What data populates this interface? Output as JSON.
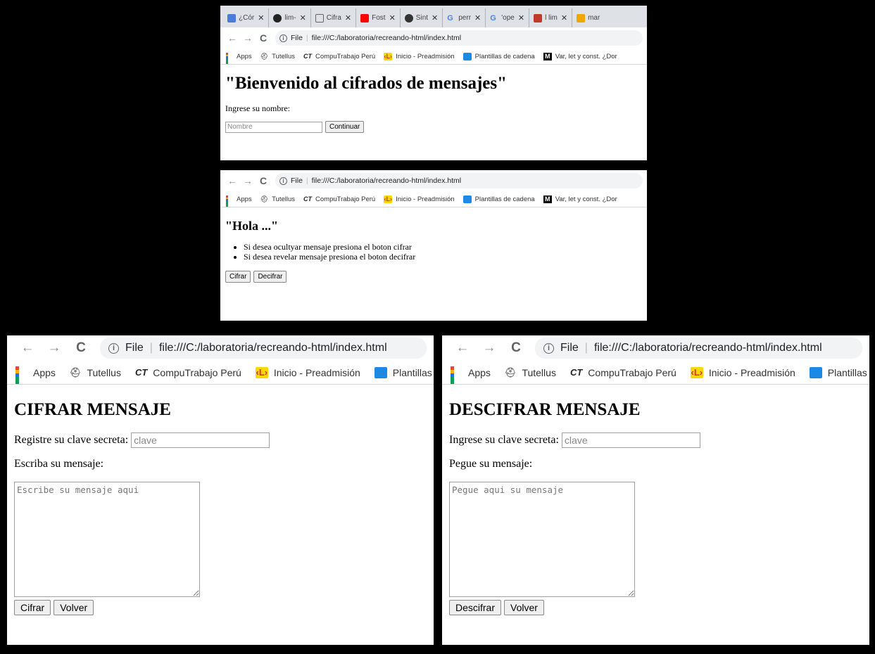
{
  "browser": {
    "tabs": [
      {
        "label": "¿Cór",
        "icon": "translate-icon",
        "color": "#4a7ddb"
      },
      {
        "label": "lim-",
        "icon": "github-icon",
        "color": "#222222"
      },
      {
        "label": "Cifra",
        "icon": "file-icon",
        "color": "#ffffff"
      },
      {
        "label": "Fost",
        "icon": "youtube-icon",
        "color": "#ff0000"
      },
      {
        "label": "Sint",
        "icon": "platzi-icon",
        "color": "#333333"
      },
      {
        "label": "perr",
        "icon": "google-icon",
        "color": "#4285f4"
      },
      {
        "label": "'ope",
        "icon": "google-icon",
        "color": "#4285f4"
      },
      {
        "label": "l lim",
        "icon": "laboratoria-icon",
        "color": "#c0392b"
      },
      {
        "label": "mar",
        "icon": "wrench-icon",
        "color": "#f0a500"
      }
    ],
    "address": {
      "scheme": "File",
      "url": "file:///C:/laboratoria/recreando-html/index.html"
    },
    "bookmarks": [
      {
        "label": "Apps",
        "icon": "apps-grid-icon"
      },
      {
        "label": "Tutellus",
        "icon": "tutellus-icon"
      },
      {
        "label": "CompuTrabajo Perú",
        "icon": "computrabajo-icon",
        "glyph": "CT"
      },
      {
        "label": "Inicio - Preadmisión",
        "icon": "preadmision-icon",
        "glyph": "‹L›"
      },
      {
        "label": "Plantillas de cadena",
        "icon": "plantillas-icon"
      },
      {
        "label": "Var, let y const. ¿Dor",
        "icon": "medium-icon",
        "glyph": "M"
      }
    ]
  },
  "screen1": {
    "title": "\"Bienvenido al cifrados de mensajes\"",
    "name_label": "Ingrese su nombre:",
    "name_placeholder": "Nombre",
    "continue_button": "Continuar"
  },
  "screen2": {
    "title": "\"Hola ...\"",
    "instructions": [
      "Si desea ocultyar mensaje presiona el boton cifrar",
      "Si desea revelar mensaje presiona el boton decifrar"
    ],
    "cipher_button": "Cifrar",
    "decipher_button": "Decifrar"
  },
  "screen3": {
    "title": "CIFRAR MENSAJE",
    "key_label": "Registre su clave secreta:",
    "key_placeholder": "clave",
    "message_label": "Escriba su mensaje:",
    "message_placeholder": "Escribe su mensaje aqui",
    "cipher_button": "Cifrar",
    "back_button": "Volver"
  },
  "screen4": {
    "title": "DESCIFRAR MENSAJE",
    "key_label": "Ingrese su clave secreta:",
    "key_placeholder": "clave",
    "message_label": "Pegue su mensaje:",
    "message_placeholder": "Pegue aqui su mensaje",
    "decipher_button": "Descifrar",
    "back_button": "Volver"
  }
}
